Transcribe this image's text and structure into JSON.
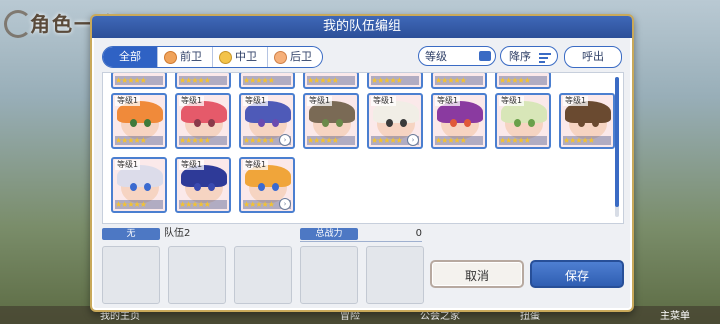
{
  "background": {
    "title": "角色一览",
    "nav": [
      "我的主页",
      "冒险",
      "公会之家",
      "扭蛋",
      "主菜单"
    ]
  },
  "dialog": {
    "title": "我的队伍编组",
    "filters": [
      {
        "label": "全部",
        "active": true
      },
      {
        "label": "前卫",
        "active": false
      },
      {
        "label": "中卫",
        "active": false
      },
      {
        "label": "后卫",
        "active": false
      }
    ],
    "sort_label": "等级",
    "order_label": "降序",
    "call_label": "呼出"
  },
  "roster": {
    "partial_row": [
      {
        "stars": "★★★★★"
      },
      {
        "stars": "★★★★★"
      },
      {
        "stars": "★★★★★"
      },
      {
        "stars": "★★★★★"
      },
      {
        "stars": "★★★★★"
      },
      {
        "stars": "★★★★★"
      },
      {
        "stars": "★★★★★"
      }
    ],
    "cards": [
      {
        "level": "等级1",
        "stars": "★★★★★",
        "hair": "#f08a3a",
        "eye": "#3e7a3a"
      },
      {
        "level": "等级1",
        "stars": "★★★★★",
        "hair": "#e55a6a",
        "eye": "#8a3a4a"
      },
      {
        "level": "等级1",
        "stars": "★★★★★",
        "hair": "#4e5ab8",
        "eye": "#6a4ab0"
      },
      {
        "level": "等级1",
        "stars": "★★★★★",
        "hair": "#7a6a55",
        "eye": "#6a8a4a"
      },
      {
        "level": "等级1",
        "stars": "★★★★★",
        "hair": "#f1eee6",
        "eye": "#3a3a3a"
      },
      {
        "level": "等级1",
        "stars": "★★★★★",
        "hair": "#8a3aa0",
        "eye": "#e05a3a"
      },
      {
        "level": "等级1",
        "stars": "★★★★★",
        "hair": "#d8e6b8",
        "eye": "#6aa04a"
      },
      {
        "level": "等级1",
        "stars": "★★★★★",
        "hair": "#6a4a30",
        "eye": "#6a4a30"
      },
      {
        "level": "等级1",
        "stars": "★★★★★",
        "hair": "#dcdcea",
        "eye": "#3a6ad0"
      },
      {
        "level": "等级1",
        "stars": "★★★★★",
        "hair": "#2e3a98",
        "eye": "#3a4ab0"
      },
      {
        "level": "等级1",
        "stars": "★★★★★",
        "hair": "#f0a53a",
        "eye": "#3a6ad0"
      }
    ]
  },
  "team": {
    "badge": "无",
    "name": "队伍2",
    "power_label": "总战力",
    "power_value": "0"
  },
  "buttons": {
    "cancel": "取消",
    "save": "保存"
  }
}
